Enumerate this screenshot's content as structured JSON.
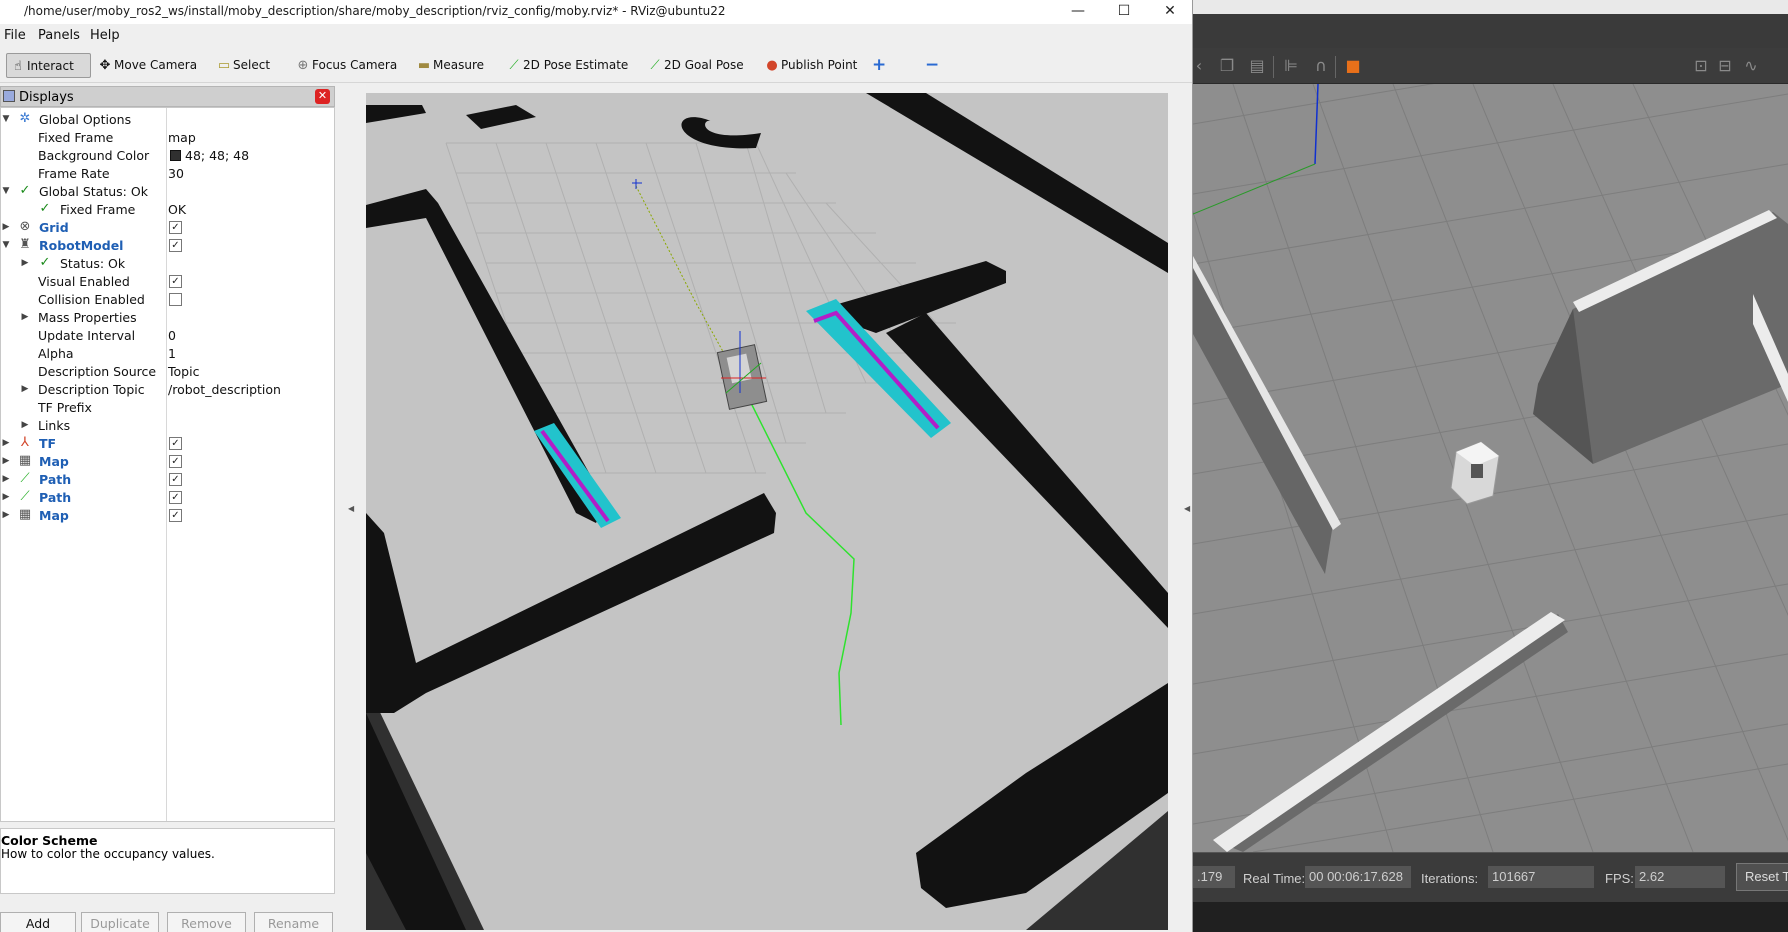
{
  "rviz": {
    "title": "/home/user/moby_ros2_ws/install/moby_description/share/moby_description/rviz_config/moby.rviz* - RViz@ubuntu22",
    "window_controls": {
      "minimize": "—",
      "maximize": "☐",
      "close": "✕"
    },
    "menu": [
      "File",
      "Panels",
      "Help"
    ],
    "toolbar": {
      "interact": "Interact",
      "move_camera": "Move Camera",
      "select": "Select",
      "focus_camera": "Focus Camera",
      "measure": "Measure",
      "pose_estimate": "2D Pose Estimate",
      "goal_pose": "2D Goal Pose",
      "publish_point": "Publish Point",
      "add_tool": "+",
      "remove_tool": "−"
    },
    "displays_panel": {
      "title": "Displays",
      "rows": [
        {
          "label": "Global Options",
          "value": ""
        },
        {
          "label": "Fixed Frame",
          "value": "map"
        },
        {
          "label": "Background Color",
          "value": "48; 48; 48"
        },
        {
          "label": "Frame Rate",
          "value": "30"
        },
        {
          "label": "Global Status: Ok",
          "value": ""
        },
        {
          "label": "Fixed Frame",
          "value": "OK"
        },
        {
          "label": "Grid",
          "value": ""
        },
        {
          "label": "RobotModel",
          "value": ""
        },
        {
          "label": "Status: Ok",
          "value": ""
        },
        {
          "label": "Visual Enabled",
          "value": ""
        },
        {
          "label": "Collision Enabled",
          "value": ""
        },
        {
          "label": "Mass Properties",
          "value": ""
        },
        {
          "label": "Update Interval",
          "value": "0"
        },
        {
          "label": "Alpha",
          "value": "1"
        },
        {
          "label": "Description Source",
          "value": "Topic"
        },
        {
          "label": "Description Topic",
          "value": "/robot_description"
        },
        {
          "label": "TF Prefix",
          "value": ""
        },
        {
          "label": "Links",
          "value": ""
        },
        {
          "label": "TF",
          "value": ""
        },
        {
          "label": "Map",
          "value": ""
        },
        {
          "label": "Path",
          "value": ""
        },
        {
          "label": "Path",
          "value": ""
        },
        {
          "label": "Map",
          "value": ""
        }
      ],
      "description_title": "Color Scheme",
      "description_text": "How to color the occupancy values.",
      "buttons": {
        "add": "Add",
        "duplicate": "Duplicate",
        "remove": "Remove",
        "rename": "Rename"
      }
    },
    "background_color": "#303030",
    "costmap_color": "#22c3cc",
    "inflation_color": "#b21ec8",
    "path_color": "#2ee22e"
  },
  "gazebo": {
    "sim_time_partial": ".179",
    "real_time_label": "Real Time:",
    "real_time_value": "00 00:06:17.628",
    "iterations_label": "Iterations:",
    "iterations_value": "101667",
    "fps_label": "FPS:",
    "fps_value": "2.62",
    "reset_label": "Reset T"
  }
}
